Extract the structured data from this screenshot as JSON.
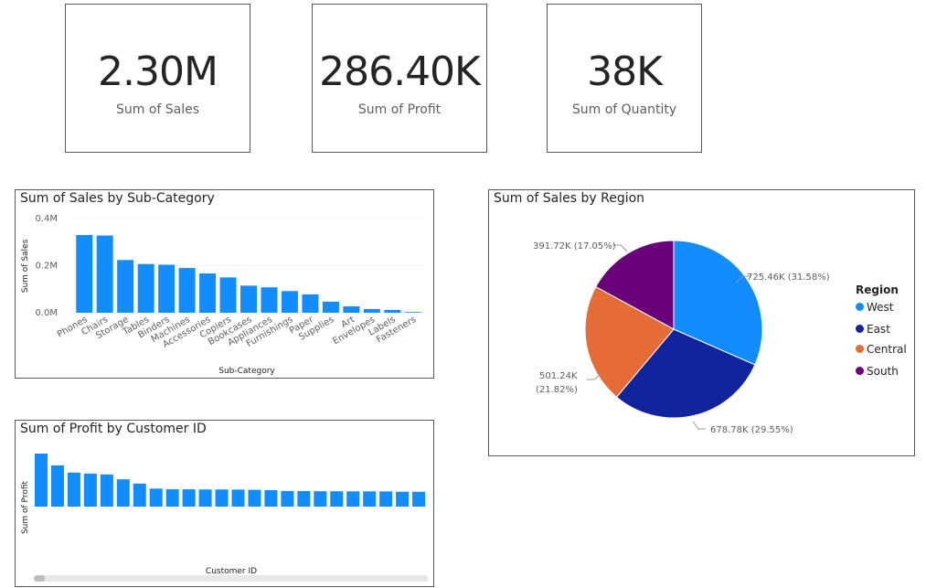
{
  "kpis": [
    {
      "value": "2.30M",
      "label": "Sum of Sales"
    },
    {
      "value": "286.40K",
      "label": "Sum of Profit"
    },
    {
      "value": "38K",
      "label": "Sum of Quantity"
    }
  ],
  "colors": {
    "bar": "#118DFF",
    "west": "#118DFF",
    "east": "#12239E",
    "central": "#E66C37",
    "south": "#6B007B"
  },
  "chart_data": [
    {
      "type": "bar",
      "title": "Sum of Sales by Sub-Category",
      "xlabel": "Sub-Category",
      "ylabel": "Sum of Sales",
      "ylim": [
        0,
        0.4
      ],
      "yticks": [
        0,
        0.2,
        0.4
      ],
      "ytick_labels": [
        "0.0M",
        "0.2M",
        "0.4M"
      ],
      "grid": true,
      "categories": [
        "Phones",
        "Chairs",
        "Storage",
        "Tables",
        "Binders",
        "Machines",
        "Accessories",
        "Copiers",
        "Bookcases",
        "Appliances",
        "Furnishings",
        "Paper",
        "Supplies",
        "Art",
        "Envelopes",
        "Labels",
        "Fasteners"
      ],
      "values": [
        0.33,
        0.328,
        0.224,
        0.207,
        0.204,
        0.19,
        0.167,
        0.15,
        0.115,
        0.108,
        0.092,
        0.078,
        0.047,
        0.027,
        0.016,
        0.012,
        0.003
      ]
    },
    {
      "type": "bar",
      "title": "Sum of Profit by Customer ID",
      "xlabel": "Customer ID",
      "ylabel": "Sum of Profit",
      "values": [
        8.98,
        6.98,
        5.76,
        5.6,
        5.44,
        4.62,
        3.9,
        3.05,
        2.93,
        2.93,
        2.9,
        2.9,
        2.88,
        2.85,
        2.8,
        2.65,
        2.64,
        2.6,
        2.6,
        2.58,
        2.58,
        2.57,
        2.52,
        2.51
      ]
    },
    {
      "type": "pie",
      "title": "Sum of Sales by Region",
      "legend_title": "Region",
      "legend_position": "right",
      "slices": [
        {
          "name": "West",
          "value": 725.46,
          "label": "725.46K (31.58%)",
          "color_key": "west"
        },
        {
          "name": "East",
          "value": 678.78,
          "label": "678.78K (29.55%)",
          "color_key": "east"
        },
        {
          "name": "Central",
          "value": 501.24,
          "label_line1": "501.24K",
          "label_line2": "(21.82%)",
          "color_key": "central"
        },
        {
          "name": "South",
          "value": 391.72,
          "label": "391.72K (17.05%)",
          "color_key": "south"
        }
      ]
    }
  ]
}
